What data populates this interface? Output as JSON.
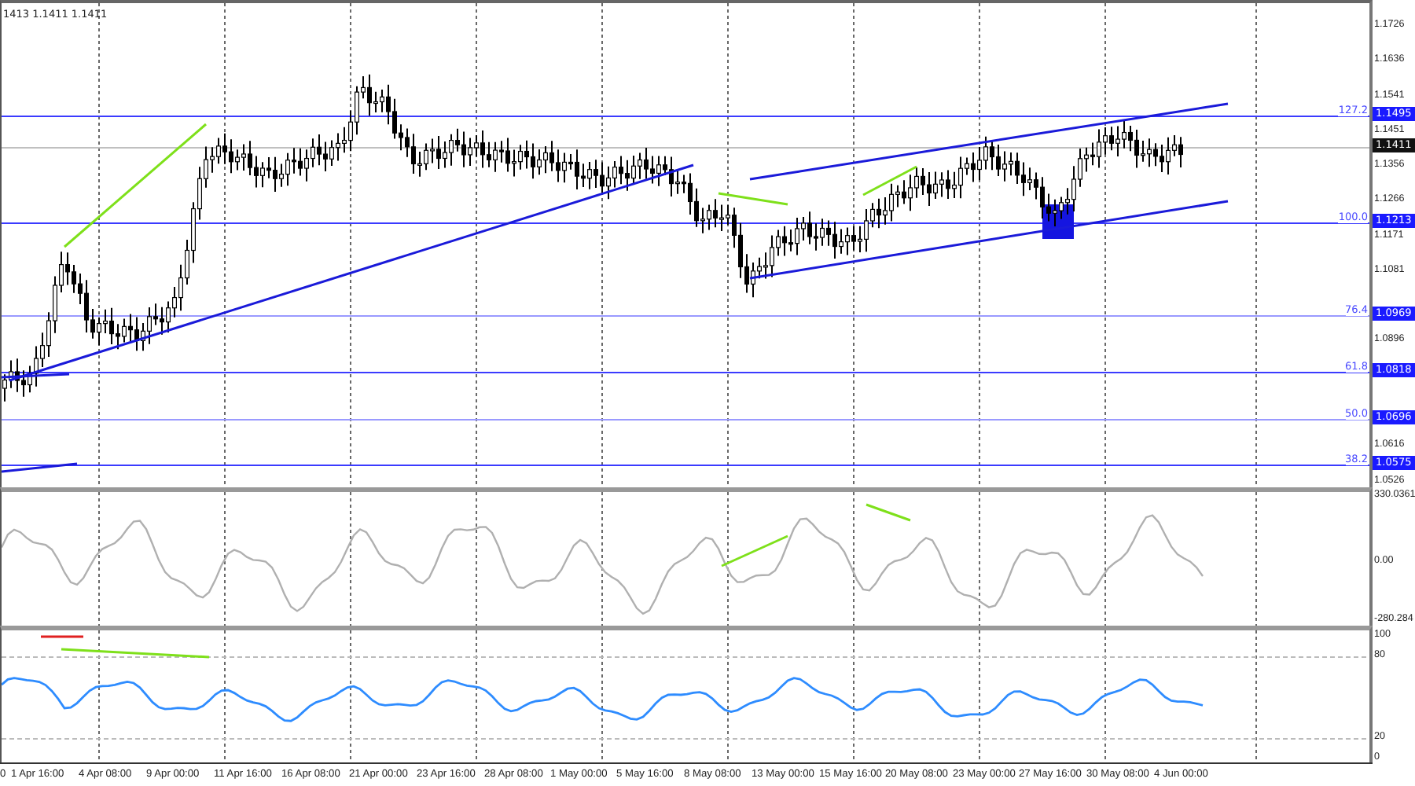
{
  "header": {
    "text": "1413 1.1411 1.1411"
  },
  "price_axis": {
    "ticks": [
      "1.1726",
      "1.1636",
      "1.1541",
      "1.1451",
      "1.1356",
      "1.1266",
      "1.1171",
      "1.1081",
      "1.0896",
      "1.0616",
      "1.0526"
    ]
  },
  "levels": [
    {
      "label": "127.2",
      "badge": "1.1495",
      "kind": "fib",
      "color": "#3b3bff"
    },
    {
      "badge": "1.1411",
      "kind": "current",
      "color": "#c0c0c0"
    },
    {
      "label": "100.0",
      "badge": "1.1213",
      "kind": "fib",
      "color": "#3b3bff"
    },
    {
      "label": "76.4",
      "badge": "1.0969",
      "kind": "fib",
      "color": "#9a9aff"
    },
    {
      "label": "61.8",
      "badge": "1.0818",
      "kind": "fib",
      "color": "#3b3bff"
    },
    {
      "label": "50.0",
      "badge": "1.0696",
      "kind": "fib",
      "color": "#9a9aff"
    },
    {
      "label": "38.2",
      "badge": "1.0575",
      "kind": "fib",
      "color": "#3b3bff"
    }
  ],
  "cci_axis": {
    "labels": [
      "330.0361",
      "0.00",
      "-280.284"
    ]
  },
  "rsi_axis": {
    "labels": [
      "100",
      "80",
      "20",
      "0"
    ]
  },
  "time_axis": {
    "labels": [
      "0",
      "1 Apr 16:00",
      "4 Apr 08:00",
      "9 Apr 00:00",
      "11 Apr 16:00",
      "16 Apr 08:00",
      "21 Apr 00:00",
      "23 Apr 16:00",
      "28 Apr 08:00",
      "1 May 00:00",
      "5 May 16:00",
      "8 May 08:00",
      "13 May 00:00",
      "15 May 16:00",
      "20 May 08:00",
      "23 May 00:00",
      "27 May 16:00",
      "30 May 08:00",
      "4 Jun 00:00"
    ]
  }
}
